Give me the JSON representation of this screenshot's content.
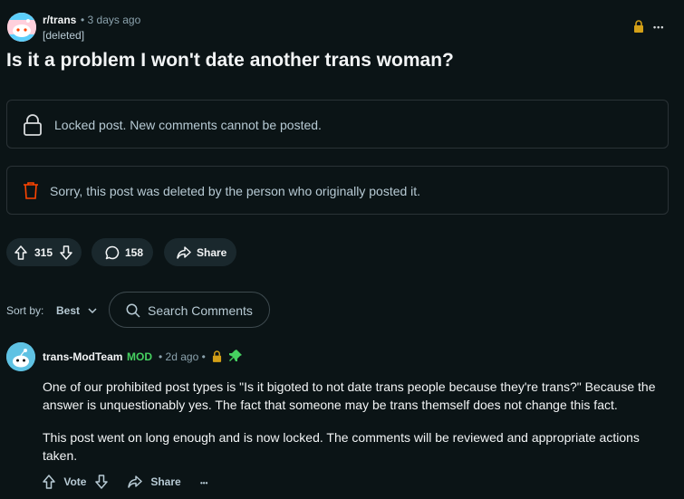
{
  "post": {
    "subreddit": "r/trans",
    "time": "• 3 days ago",
    "author": "[deleted]",
    "title": "Is it a problem I won't date another trans woman?",
    "more": "•••"
  },
  "notices": {
    "locked": "Locked post. New comments cannot be posted.",
    "deleted": "Sorry, this post was deleted by the person who originally posted it."
  },
  "actions": {
    "votes": "315",
    "comments": "158",
    "share": "Share"
  },
  "sort": {
    "label": "Sort by:",
    "value": "Best"
  },
  "search": {
    "placeholder": "Search Comments"
  },
  "comment": {
    "author": "trans-ModTeam",
    "badge": "MOD",
    "time": "• 2d ago •",
    "paragraphs": [
      "One of our prohibited post types is \"Is it bigoted to not date trans people because they're trans?\" Because the answer is unquestionably yes. The fact that someone may be trans themself does not change this fact.",
      "This post went on long enough and is now locked. The comments will be reviewed and appropriate actions taken."
    ],
    "vote_label": "Vote",
    "share_label": "Share",
    "more": "•••"
  },
  "colors": {
    "background": "#0b1416",
    "mod": "#46d160",
    "lock": "#d4a017",
    "delete": "#ff4500",
    "pin": "#46d160"
  },
  "icons": [
    "snoo-avatar-icon",
    "lock-icon",
    "more-icon",
    "trash-icon",
    "upvote-icon",
    "downvote-icon",
    "comment-icon",
    "share-icon",
    "search-icon",
    "chevron-down-icon",
    "pin-icon"
  ]
}
